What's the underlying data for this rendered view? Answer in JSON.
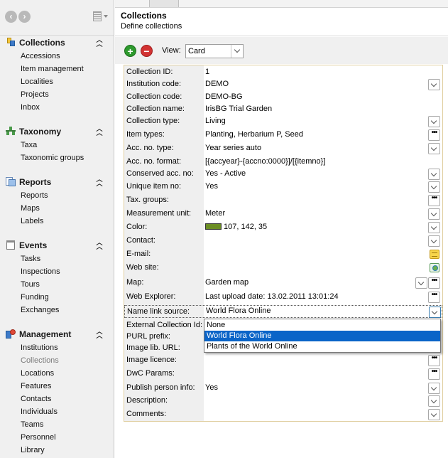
{
  "sidebar": {
    "sections": [
      {
        "title": "Collections",
        "icon": "collections-icon",
        "items": [
          "Accessions",
          "Item management",
          "Localities",
          "Projects",
          "Inbox"
        ]
      },
      {
        "title": "Taxonomy",
        "icon": "taxonomy-icon",
        "items": [
          "Taxa",
          "Taxonomic groups"
        ]
      },
      {
        "title": "Reports",
        "icon": "reports-icon",
        "items": [
          "Reports",
          "Maps",
          "Labels"
        ]
      },
      {
        "title": "Events",
        "icon": "events-icon",
        "items": [
          "Tasks",
          "Inspections",
          "Tours",
          "Funding",
          "Exchanges"
        ]
      },
      {
        "title": "Management",
        "icon": "management-icon",
        "items": [
          "Institutions",
          "Collections",
          "Locations",
          "Features",
          "Contacts",
          "Individuals",
          "Teams",
          "Personnel",
          "Library"
        ],
        "selected": "Collections"
      }
    ]
  },
  "header": {
    "title": "Collections",
    "subtitle": "Define collections"
  },
  "toolbar": {
    "view_label": "View:",
    "view_value": "Card"
  },
  "form": {
    "fields": [
      {
        "label": "Collection ID:",
        "value": "1",
        "control": "none"
      },
      {
        "label": "Institution code:",
        "value": "DEMO",
        "control": "dropdown"
      },
      {
        "label": "Collection code:",
        "value": "DEMO-BG",
        "control": "none"
      },
      {
        "label": "Collection name:",
        "value": "IrisBG Trial Garden",
        "control": "none"
      },
      {
        "label": "Collection type:",
        "value": "Living",
        "control": "dropdown"
      },
      {
        "label": "Item types:",
        "value": "Planting, Herbarium P, Seed",
        "control": "dots"
      },
      {
        "label": "Acc. no. type:",
        "value": "Year series auto",
        "control": "dropdown"
      },
      {
        "label": "Acc. no. format:",
        "value": "[{accyear}-{accno:0000}]/[{itemno}]",
        "control": "none"
      },
      {
        "label": "Conserved acc. no:",
        "value": "Yes - Active",
        "control": "dropdown"
      },
      {
        "label": "Unique item no:",
        "value": "Yes",
        "control": "dropdown"
      },
      {
        "label": "Tax. groups:",
        "value": "",
        "control": "dots"
      },
      {
        "label": "Measurement unit:",
        "value": "Meter",
        "control": "dropdown"
      },
      {
        "label": "Color:",
        "value": "107, 142, 35",
        "control": "dropdown",
        "swatch": "#6b8e23"
      },
      {
        "label": "Contact:",
        "value": "",
        "control": "dropdown"
      },
      {
        "label": "E-mail:",
        "value": "",
        "control": "mail"
      },
      {
        "label": "Web site:",
        "value": "",
        "control": "web"
      },
      {
        "label": "Map:",
        "value": "Garden map",
        "control": "dropdown+dots"
      },
      {
        "label": "Web Explorer:",
        "value": "Last upload date: 13.02.2011 13:01:24",
        "control": "dots"
      },
      {
        "label": "Name link source:",
        "value": "World Flora Online",
        "control": "dropdown-open"
      },
      {
        "label": "External Collection Id:",
        "value": "",
        "control": "none"
      },
      {
        "label": "PURL prefix:",
        "value": "",
        "control": "none"
      },
      {
        "label": "Image lib. URL:",
        "value": "",
        "control": "none"
      },
      {
        "label": "Image licence:",
        "value": "",
        "control": "dots"
      },
      {
        "label": "DwC Params:",
        "value": "",
        "control": "dots"
      },
      {
        "label": "Publish person info:",
        "value": "Yes",
        "control": "dropdown"
      },
      {
        "label": "Description:",
        "value": "",
        "control": "dropdown"
      },
      {
        "label": "Comments:",
        "value": "",
        "control": "dropdown"
      }
    ]
  },
  "name_link_dropdown": {
    "options": [
      "None",
      "World Flora Online",
      "Plants of the World Online"
    ],
    "selected_index": 1
  }
}
